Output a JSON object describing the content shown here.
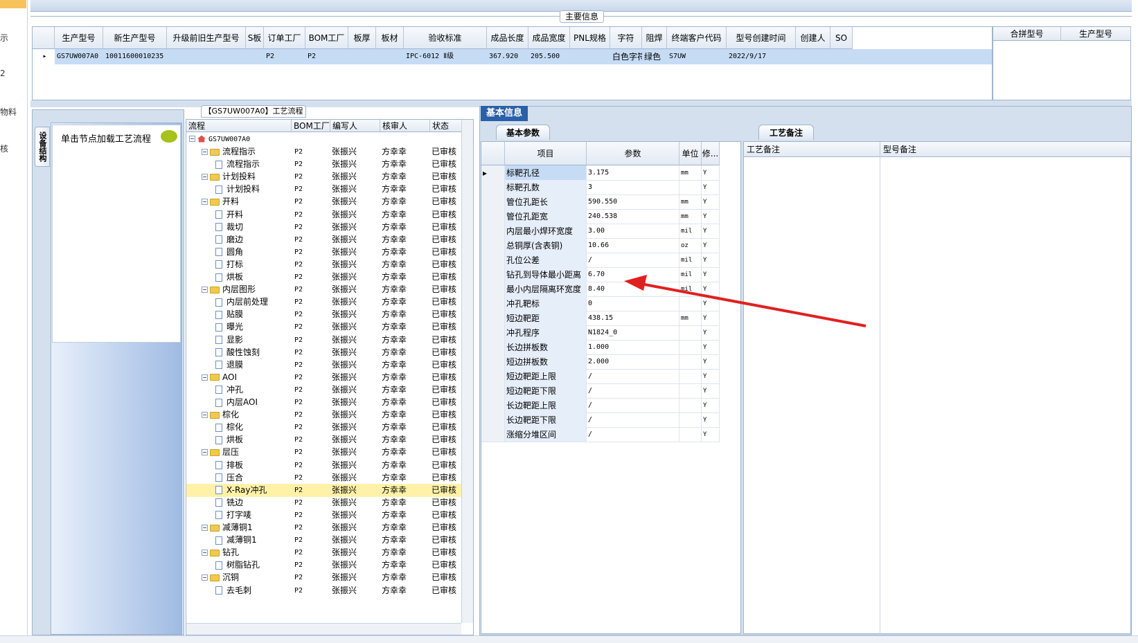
{
  "left_strip": {
    "items": [
      "示",
      "2",
      "物料",
      "核"
    ]
  },
  "main_info": {
    "legend": "主要信息",
    "columns": [
      "生产型号",
      "新生产型号",
      "升级前旧生产型号",
      "S板",
      "订单工厂",
      "BOM工厂",
      "板厚",
      "板材",
      "验收标准",
      "成品长度",
      "成品宽度",
      "PNL规格",
      "字符",
      "阻焊",
      "终端客户代码",
      "型号创建时间",
      "创建人",
      "SO"
    ],
    "row": {
      "生产型号": "GS7UW007A0",
      "新生产型号": "10011600010235",
      "升级前旧生产型号": "",
      "S板": "",
      "订单工厂": "P2",
      "BOM工厂": "P2",
      "板厚": "",
      "板材": "",
      "验收标准": "IPC-6012 Ⅱ级",
      "成品长度": "367.920",
      "成品宽度": "205.500",
      "PNL规格": "",
      "字符": "白色字符",
      "阻焊": "绿色",
      "终端客户代码": "S7UW",
      "型号创建时间": "2022/9/17",
      "创建人": "",
      "SO": ""
    },
    "merge_columns": [
      "合拼型号",
      "生产型号"
    ]
  },
  "left_panel": {
    "vertical_tab": "设备结构",
    "hint": "单击节点加载工艺流程"
  },
  "tree": {
    "title": "【GS7UW007A0】工艺流程",
    "columns": [
      "流程",
      "BOM工厂",
      "编写人",
      "核审人",
      "状态"
    ],
    "root": "GS7UW007A0",
    "rows": [
      {
        "name": "流程指示",
        "level": 1,
        "type": "folder",
        "factory": "P2",
        "writer": "张振兴",
        "reviewer": "方幸幸",
        "status": "已审核"
      },
      {
        "name": "流程指示",
        "level": 2,
        "type": "doc",
        "factory": "P2",
        "writer": "张振兴",
        "reviewer": "方幸幸",
        "status": "已审核"
      },
      {
        "name": "计划投料",
        "level": 1,
        "type": "folder",
        "factory": "P2",
        "writer": "张振兴",
        "reviewer": "方幸幸",
        "status": "已审核"
      },
      {
        "name": "计划投料",
        "level": 2,
        "type": "doc",
        "factory": "P2",
        "writer": "张振兴",
        "reviewer": "方幸幸",
        "status": "已审核"
      },
      {
        "name": "开料",
        "level": 1,
        "type": "folder",
        "factory": "P2",
        "writer": "张振兴",
        "reviewer": "方幸幸",
        "status": "已审核"
      },
      {
        "name": "开料",
        "level": 2,
        "type": "doc",
        "factory": "P2",
        "writer": "张振兴",
        "reviewer": "方幸幸",
        "status": "已审核"
      },
      {
        "name": "裁切",
        "level": 2,
        "type": "doc",
        "factory": "P2",
        "writer": "张振兴",
        "reviewer": "方幸幸",
        "status": "已审核"
      },
      {
        "name": "磨边",
        "level": 2,
        "type": "doc",
        "factory": "P2",
        "writer": "张振兴",
        "reviewer": "方幸幸",
        "status": "已审核"
      },
      {
        "name": "圆角",
        "level": 2,
        "type": "doc",
        "factory": "P2",
        "writer": "张振兴",
        "reviewer": "方幸幸",
        "status": "已审核"
      },
      {
        "name": "打标",
        "level": 2,
        "type": "doc",
        "factory": "P2",
        "writer": "张振兴",
        "reviewer": "方幸幸",
        "status": "已审核"
      },
      {
        "name": "烘板",
        "level": 2,
        "type": "doc",
        "factory": "P2",
        "writer": "张振兴",
        "reviewer": "方幸幸",
        "status": "已审核"
      },
      {
        "name": "内层图形",
        "level": 1,
        "type": "folder",
        "factory": "P2",
        "writer": "张振兴",
        "reviewer": "方幸幸",
        "status": "已审核"
      },
      {
        "name": "内层前处理",
        "level": 2,
        "type": "doc",
        "factory": "P2",
        "writer": "张振兴",
        "reviewer": "方幸幸",
        "status": "已审核"
      },
      {
        "name": "贴膜",
        "level": 2,
        "type": "doc",
        "factory": "P2",
        "writer": "张振兴",
        "reviewer": "方幸幸",
        "status": "已审核"
      },
      {
        "name": "曝光",
        "level": 2,
        "type": "doc",
        "factory": "P2",
        "writer": "张振兴",
        "reviewer": "方幸幸",
        "status": "已审核"
      },
      {
        "name": "显影",
        "level": 2,
        "type": "doc",
        "factory": "P2",
        "writer": "张振兴",
        "reviewer": "方幸幸",
        "status": "已审核"
      },
      {
        "name": "酸性蚀刻",
        "level": 2,
        "type": "doc",
        "factory": "P2",
        "writer": "张振兴",
        "reviewer": "方幸幸",
        "status": "已审核"
      },
      {
        "name": "退膜",
        "level": 2,
        "type": "doc",
        "factory": "P2",
        "writer": "张振兴",
        "reviewer": "方幸幸",
        "status": "已审核"
      },
      {
        "name": "AOI",
        "level": 1,
        "type": "folder",
        "factory": "P2",
        "writer": "张振兴",
        "reviewer": "方幸幸",
        "status": "已审核"
      },
      {
        "name": "冲孔",
        "level": 2,
        "type": "doc",
        "factory": "P2",
        "writer": "张振兴",
        "reviewer": "方幸幸",
        "status": "已审核"
      },
      {
        "name": "内层AOI",
        "level": 2,
        "type": "doc",
        "factory": "P2",
        "writer": "张振兴",
        "reviewer": "方幸幸",
        "status": "已审核"
      },
      {
        "name": "棕化",
        "level": 1,
        "type": "folder",
        "factory": "P2",
        "writer": "张振兴",
        "reviewer": "方幸幸",
        "status": "已审核"
      },
      {
        "name": "棕化",
        "level": 2,
        "type": "doc",
        "factory": "P2",
        "writer": "张振兴",
        "reviewer": "方幸幸",
        "status": "已审核"
      },
      {
        "name": "烘板",
        "level": 2,
        "type": "doc",
        "factory": "P2",
        "writer": "张振兴",
        "reviewer": "方幸幸",
        "status": "已审核"
      },
      {
        "name": "层压",
        "level": 1,
        "type": "folder",
        "factory": "P2",
        "writer": "张振兴",
        "reviewer": "方幸幸",
        "status": "已审核"
      },
      {
        "name": "排板",
        "level": 2,
        "type": "doc",
        "factory": "P2",
        "writer": "张振兴",
        "reviewer": "方幸幸",
        "status": "已审核"
      },
      {
        "name": "压合",
        "level": 2,
        "type": "doc",
        "factory": "P2",
        "writer": "张振兴",
        "reviewer": "方幸幸",
        "status": "已审核"
      },
      {
        "name": "X-Ray冲孔",
        "level": 2,
        "type": "doc",
        "factory": "P2",
        "writer": "张振兴",
        "reviewer": "方幸幸",
        "status": "已审核",
        "selected": true
      },
      {
        "name": "铣边",
        "level": 2,
        "type": "doc",
        "factory": "P2",
        "writer": "张振兴",
        "reviewer": "方幸幸",
        "status": "已审核"
      },
      {
        "name": "打字唛",
        "level": 2,
        "type": "doc",
        "factory": "P2",
        "writer": "张振兴",
        "reviewer": "方幸幸",
        "status": "已审核"
      },
      {
        "name": "减薄铜1",
        "level": 1,
        "type": "folder",
        "factory": "P2",
        "writer": "张振兴",
        "reviewer": "方幸幸",
        "status": "已审核"
      },
      {
        "name": "减薄铜1",
        "level": 2,
        "type": "doc",
        "factory": "P2",
        "writer": "张振兴",
        "reviewer": "方幸幸",
        "status": "已审核"
      },
      {
        "name": "钻孔",
        "level": 1,
        "type": "folder",
        "factory": "P2",
        "writer": "张振兴",
        "reviewer": "方幸幸",
        "status": "已审核"
      },
      {
        "name": "树脂钻孔",
        "level": 2,
        "type": "doc",
        "factory": "P2",
        "writer": "张振兴",
        "reviewer": "方幸幸",
        "status": "已审核"
      },
      {
        "name": "沉铜",
        "level": 1,
        "type": "folder",
        "factory": "P2",
        "writer": "张振兴",
        "reviewer": "方幸幸",
        "status": "已审核"
      },
      {
        "name": "去毛刺",
        "level": 2,
        "type": "doc",
        "factory": "P2",
        "writer": "张振兴",
        "reviewer": "方幸幸",
        "status": "已审核"
      }
    ]
  },
  "basic_info": {
    "tab": "基本信息",
    "params_tab": "基本参数",
    "notes_tab": "工艺备注",
    "columns": [
      "项目",
      "参数",
      "单位",
      "修..."
    ],
    "rows": [
      {
        "item": "标靶孔径",
        "value": "3.175",
        "unit": "mm",
        "mod": "Y"
      },
      {
        "item": "标靶孔数",
        "value": "3",
        "unit": "",
        "mod": "Y"
      },
      {
        "item": "管位孔距长",
        "value": "590.550",
        "unit": "mm",
        "mod": "Y"
      },
      {
        "item": "管位孔距宽",
        "value": "240.538",
        "unit": "mm",
        "mod": "Y"
      },
      {
        "item": "内层最小焊环宽度",
        "value": "3.00",
        "unit": "mil",
        "mod": "Y"
      },
      {
        "item": "总铜厚(含表铜)",
        "value": "10.66",
        "unit": "oz",
        "mod": "Y"
      },
      {
        "item": "孔位公差",
        "value": "/",
        "unit": "mil",
        "mod": "Y"
      },
      {
        "item": "钻孔到导体最小距离",
        "value": "6.70",
        "unit": "mil",
        "mod": "Y"
      },
      {
        "item": "最小内层隔离环宽度",
        "value": "8.40",
        "unit": "mil",
        "mod": "Y"
      },
      {
        "item": "冲孔靶标",
        "value": "0",
        "unit": "",
        "mod": "Y"
      },
      {
        "item": "短边靶距",
        "value": "438.15",
        "unit": "mm",
        "mod": "Y"
      },
      {
        "item": "冲孔程序",
        "value": "N1824_0",
        "unit": "",
        "mod": "Y"
      },
      {
        "item": "长边拼板数",
        "value": "1.000",
        "unit": "",
        "mod": "Y"
      },
      {
        "item": "短边拼板数",
        "value": "2.000",
        "unit": "",
        "mod": "Y"
      },
      {
        "item": "短边靶距上限",
        "value": "/",
        "unit": "",
        "mod": "Y"
      },
      {
        "item": "短边靶距下限",
        "value": "/",
        "unit": "",
        "mod": "Y"
      },
      {
        "item": "长边靶距上限",
        "value": "/",
        "unit": "",
        "mod": "Y"
      },
      {
        "item": "长边靶距下限",
        "value": "/",
        "unit": "",
        "mod": "Y"
      },
      {
        "item": "涨缩分堆区间",
        "value": "/",
        "unit": "",
        "mod": "Y"
      }
    ],
    "notes_columns": [
      "工艺备注",
      "型号备注"
    ]
  },
  "colors": {
    "accent": "#2b5fa8",
    "selection": "#c6dcf5",
    "highlight": "#fff2a8",
    "arrow": "#e02020"
  }
}
